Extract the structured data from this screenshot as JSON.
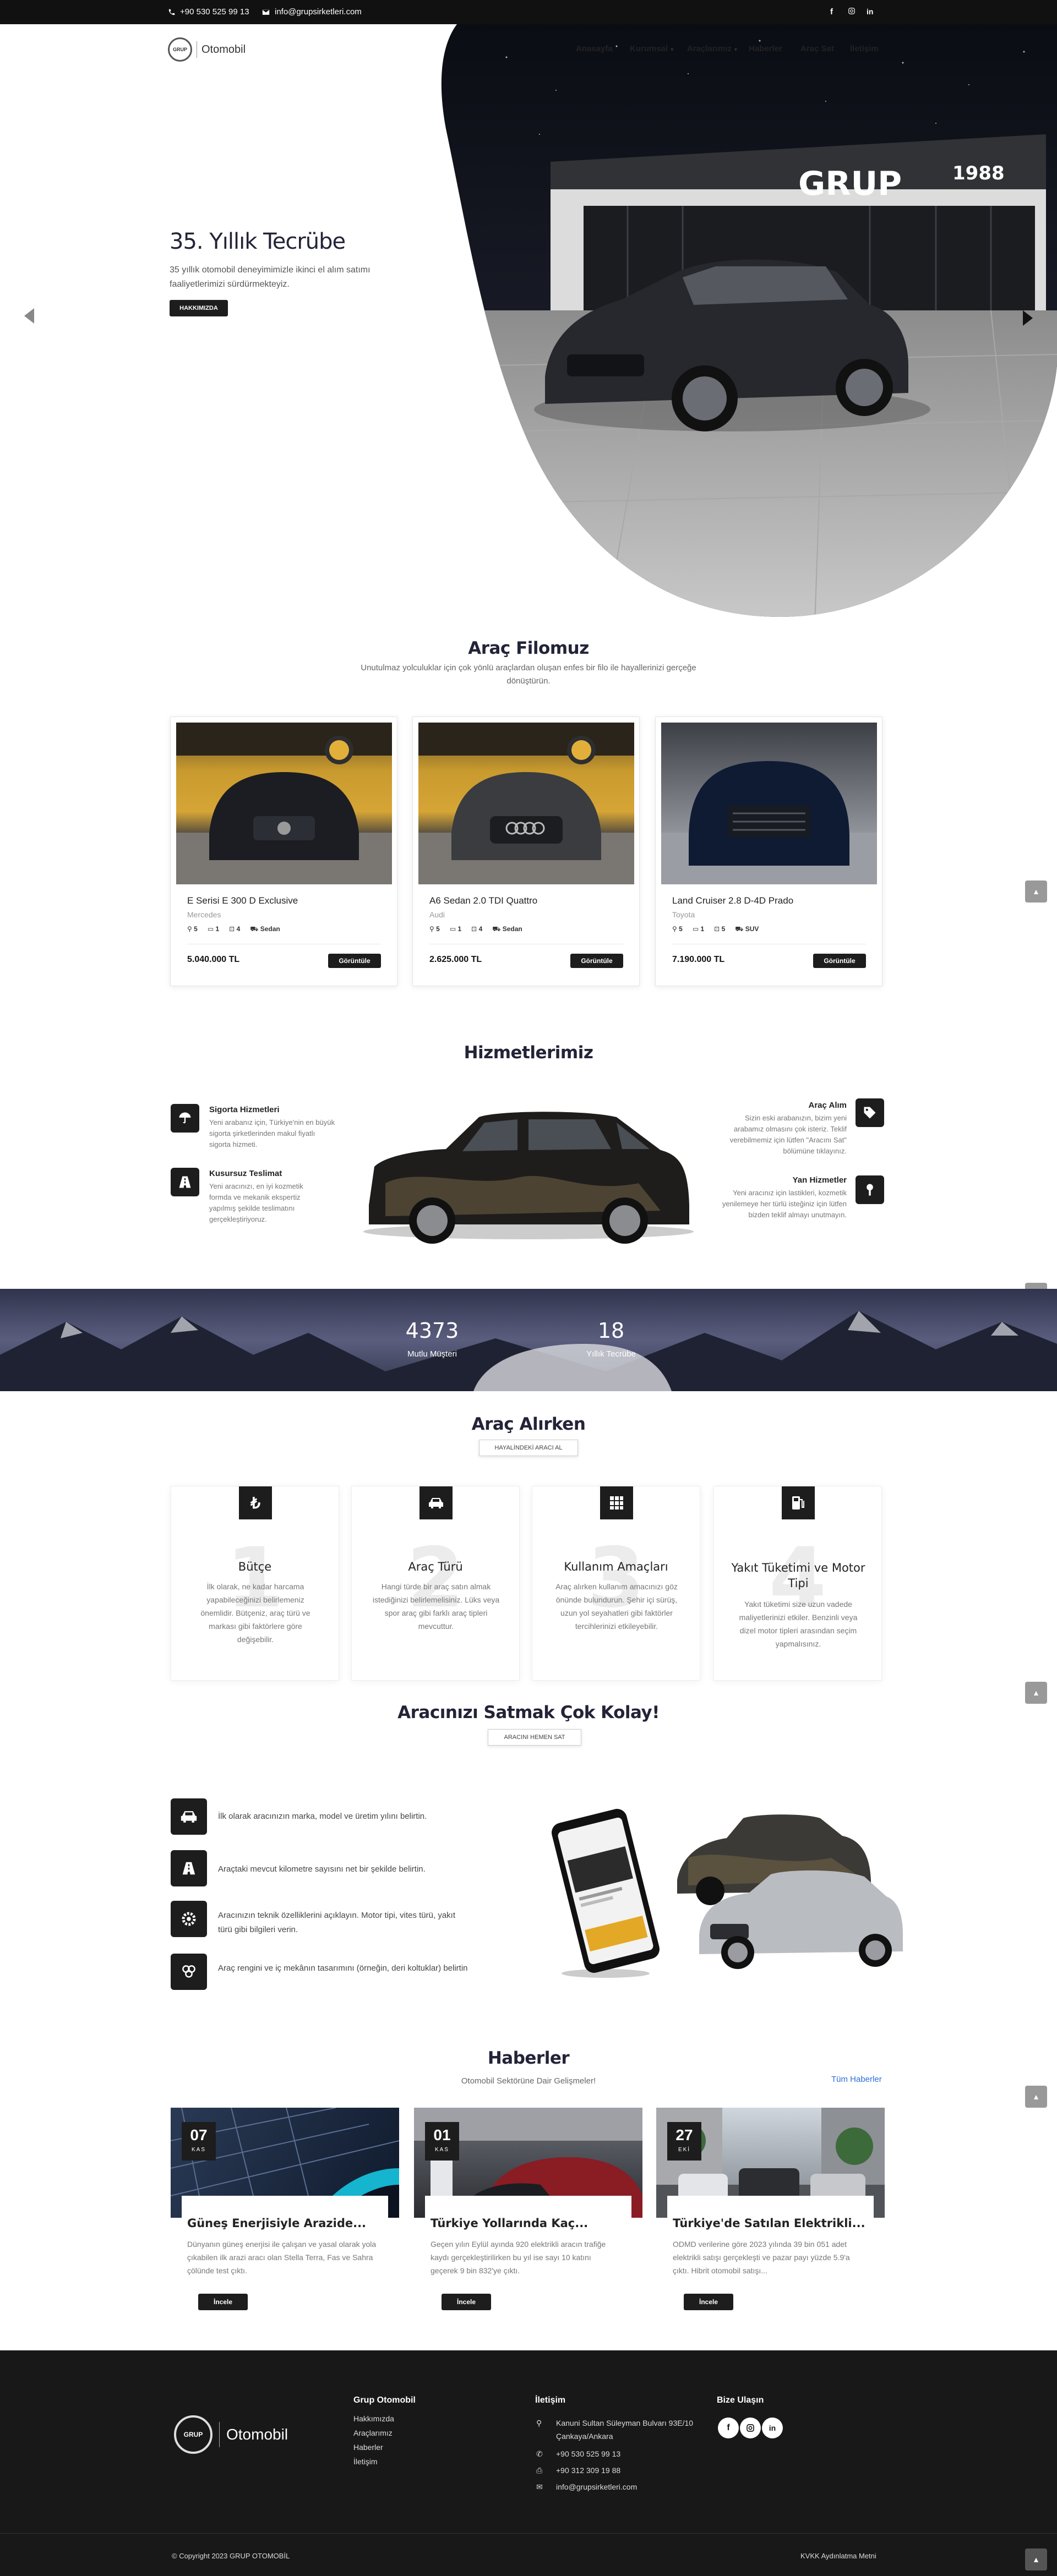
{
  "topbar": {
    "phone": "+90 530 525 99 13",
    "email": "info@grupsirketleri.com"
  },
  "brand": {
    "logo_text": "Otomobil",
    "badge": "GRUP"
  },
  "nav": {
    "items": [
      "Anasayfa",
      "Kurumsal",
      "Araçlarımız",
      "Haberler",
      "Araç Sat",
      "İletişim"
    ]
  },
  "hero": {
    "title": "35. Yıllık Tecrübe",
    "desc": "35 yıllık otomobil deneyimimizle ikinci el alım satımı faaliyetlerimizi sürdürmekteyiz.",
    "button": "HAKKIMIZDA",
    "sign": "GRUP",
    "sign_year": "1988"
  },
  "fleet": {
    "title": "Araç Filomuz",
    "subtitle": "Unutulmaz yolculuklar için çok yönlü araçlardan oluşan enfes bir filo ile hayallerinizi gerçeğe dönüştürün.",
    "cars": [
      {
        "name": "E Serisi E 300 D Exclusive",
        "brand": "Mercedes",
        "seats": "5",
        "doors": "1",
        "bags": "4",
        "body": "Sedan",
        "price": "5.040.000 TL",
        "button": "Görüntüle"
      },
      {
        "name": "A6 Sedan 2.0 TDI Quattro",
        "brand": "Audi",
        "seats": "5",
        "doors": "1",
        "bags": "4",
        "body": "Sedan",
        "price": "2.625.000 TL",
        "button": "Görüntüle"
      },
      {
        "name": "Land Cruiser 2.8 D-4D Prado",
        "brand": "Toyota",
        "seats": "5",
        "doors": "1",
        "bags": "5",
        "body": "SUV",
        "price": "7.190.000 TL",
        "button": "Görüntüle"
      }
    ]
  },
  "services": {
    "title": "Hizmetlerimiz",
    "left": [
      {
        "title": "Sigorta Hizmetleri",
        "desc": "Yeni arabanız için, Türkiye'nin en büyük sigorta şirketlerinden makul fiyatlı sigorta hizmeti."
      },
      {
        "title": "Kusursuz Teslimat",
        "desc": "Yeni aracınızı, en iyi kozmetik formda ve mekanik ekspertiz yapılmış şekilde teslimatını gerçekleştiriyoruz."
      }
    ],
    "right": [
      {
        "title": "Araç Alım",
        "desc": "Sizin eski arabanızın, bizim yeni arabamız olmasını çok isteriz. Teklif verebilmemiz için lütfen \"Aracını Sat\" bölümüne tıklayınız."
      },
      {
        "title": "Yan Hizmetler",
        "desc": "Yeni aracınız için lastikleri, kozmetik yenilemeye her türlü isteğiniz için lütfen bizden teklif almayı unutmayın."
      }
    ]
  },
  "stats": [
    {
      "value": "4373",
      "label": "Mutlu Müşteri"
    },
    {
      "value": "18",
      "label": "Yıllık Tecrübe"
    }
  ],
  "buying": {
    "title": "Araç Alırken",
    "button": "HAYALİNDEKİ ARACI AL",
    "items": [
      {
        "num": "1",
        "title": "Bütçe",
        "desc": "İlk olarak, ne kadar harcama yapabileceğinizi belirlemeniz önemlidir. Bütçeniz, araç türü ve markası gibi faktörlere göre değişebilir."
      },
      {
        "num": "2",
        "title": "Araç Türü",
        "desc": "Hangi türde bir araç satın almak istediğinizi belirlemelisiniz. Lüks veya spor araç gibi farklı araç tipleri mevcuttur."
      },
      {
        "num": "3",
        "title": "Kullanım Amaçları",
        "desc": "Araç alırken kullanım amacınızı göz önünde bulundurun. Şehir içi sürüş, uzun yol seyahatleri gibi faktörler tercihlerinizi etkileyebilir."
      },
      {
        "num": "4",
        "title": "Yakıt Tüketimi ve Motor Tipi",
        "desc": "Yakıt tüketimi size uzun vadede maliyetlerinizi etkiler. Benzinli veya dizel motor tipleri arasından seçim yapmalısınız."
      }
    ]
  },
  "sell": {
    "title": "Aracınızı Satmak Çok Kolay!",
    "button": "ARACINI HEMEN SAT",
    "steps": [
      "İlk olarak aracınızın marka, model ve üretim yılını belirtin.",
      "Araçtaki mevcut kilometre sayısını net bir şekilde belirtin.",
      "Aracınızın teknik özelliklerini açıklayın. Motor tipi, vites türü, yakıt türü gibi bilgileri verin.",
      "Araç rengini ve iç mekânın tasarımını (örneğin, deri koltuklar) belirtin"
    ]
  },
  "news": {
    "title": "Haberler",
    "subtitle": "Otomobil Sektörüne Dair Gelişmeler!",
    "all_link": "Tüm Haberler",
    "items": [
      {
        "day": "07",
        "month": "KAS",
        "title": "Güneş Enerjisiyle Arazide...",
        "desc": "Dünyanın güneş enerjisi ile çalışan ve yasal olarak yola çıkabilen ilk arazi aracı olan Stella Terra, Fas ve Sahra çölünde test çıktı.",
        "button": "İncele"
      },
      {
        "day": "01",
        "month": "KAS",
        "title": "Türkiye Yollarında Kaç...",
        "desc": "Geçen yılın Eylül ayında 920 elektrikli aracın trafiğe kaydı gerçekleştirilirken bu yıl ise sayı 10 katını geçerek 9 bin 832'ye çıktı.",
        "button": "İncele"
      },
      {
        "day": "27",
        "month": "EKİ",
        "title": "Türkiye'de Satılan Elektrikli...",
        "desc": "ODMD verilerine göre 2023 yılında 39 bin 051 adet elektrikli satışı gerçekleşti ve pazar payı yüzde 5.9'a çıktı. Hibrit otomobil satışı...",
        "button": "İncele"
      }
    ]
  },
  "footer": {
    "col1_title": "Grup Otomobil",
    "col1_links": [
      "Hakkımızda",
      "Araçlarımız",
      "Haberler",
      "İletişim"
    ],
    "col2_title": "İletişim",
    "address": "Kanuni Sultan Süleyman Bulvarı 93E/10 Çankaya/Ankara",
    "phone1": "+90 530 525 99 13",
    "phone2": "+90 312 309 19 88",
    "email": "info@grupsirketleri.com",
    "col3_title": "Bize Ulaşın",
    "copyright": "© Copyright 2023 GRUP OTOMOBİL",
    "kvkk": "KVKK Aydınlatma Metni"
  }
}
